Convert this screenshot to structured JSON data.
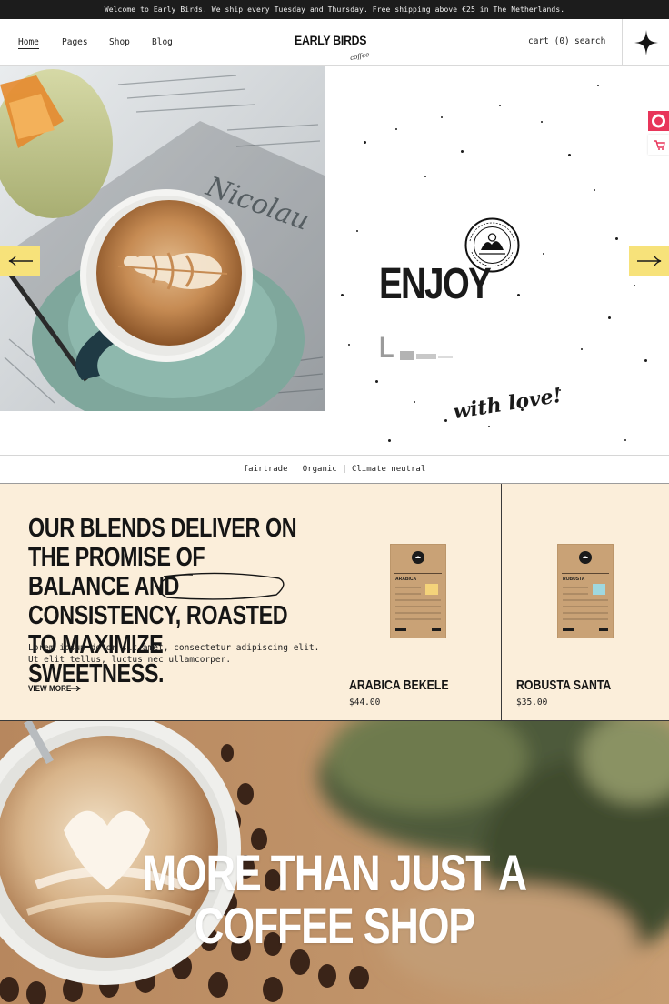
{
  "announcement": "Welcome to Early Birds. We ship every Tuesday and Thursday. Free shipping above €25 in The Netherlands.",
  "nav": {
    "items": [
      {
        "label": "Home"
      },
      {
        "label": "Pages"
      },
      {
        "label": "Shop"
      },
      {
        "label": "Blog"
      }
    ],
    "logo": "EARLY BIRDS",
    "logo_sub": "coffee",
    "cart": "cart (0)",
    "search": "search"
  },
  "hero": {
    "word1": "ENJOY",
    "word2": "L",
    "script": "with love!",
    "badge_text": "NATURAL PRODUCT · PREMIUM QUALITY"
  },
  "tagline": "fairtrade | Organic | Climate neutral",
  "intro": {
    "heading": "OUR BLENDS DELIVER ON THE PROMISE OF BALANCE AND CONSISTENCY, ROASTED TO MAXIMIZE SWEETNESS.",
    "body": "Lorem ipsum dolor sit amet, consectetur adipiscing elit. Ut elit tellus, luctus nec ullamcorper.",
    "cta": "VIEW MORE"
  },
  "products": [
    {
      "name": "ARABICA BEKELE",
      "price": "$44.00",
      "bag_label": "ARABICA",
      "accent": "#f4d37a"
    },
    {
      "name": "ROBUSTA SANTA",
      "price": "$35.00",
      "bag_label": "ROBUSTA",
      "accent": "#9fd8e0"
    }
  ],
  "banner": {
    "line1": "MORE THAN JUST A",
    "line2": "COFFEE SHOP"
  },
  "colors": {
    "accent_yellow": "#f7e27a",
    "cream": "#fbeeda",
    "side_pink": "#e8355a"
  }
}
